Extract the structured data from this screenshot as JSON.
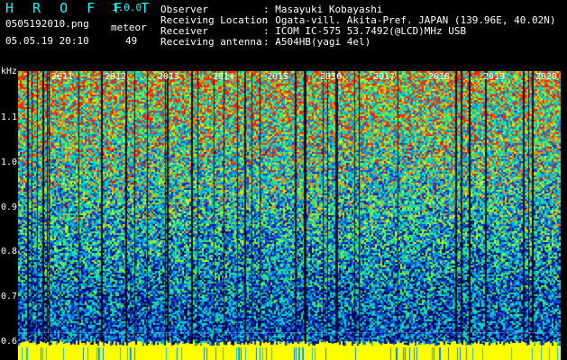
{
  "header": {
    "app_title": "H R O F F T",
    "version": "1.0.0",
    "filename": "0505192010.png",
    "meteor_label": "meteor",
    "datetime": "05.05.19 20:10",
    "meteor_count": "49"
  },
  "info": {
    "observer_label": "Observer",
    "observer_value": ": Masayuki Kobayashi",
    "location_label": "Receiving Location",
    "location_value": ": Ogata-vill. Akita-Pref. JAPAN (139.96E, 40.02N)",
    "receiver_label": "Receiver",
    "receiver_value": ": ICOM IC-575 53.7492(@LCD)MHz USB",
    "antenna_label": "Receiving antenna",
    "antenna_value": ": A504HB(yagi 4el)"
  },
  "y_axis": {
    "unit": "kHz",
    "ticks": [
      "1.1",
      "1.0",
      "0.9",
      "0.8",
      "0.7",
      "0.6"
    ]
  },
  "x_axis": {
    "years": [
      "2011",
      "2012",
      "2013",
      "2014",
      "2015",
      "2016",
      "2017",
      "2018",
      "2019",
      "2020"
    ]
  },
  "colors": {
    "header_cyan": "#00ffff",
    "baseline_yellow": "#ffff00",
    "noise_low": "#0a1a8c",
    "noise_high": "#00e0e0"
  }
}
